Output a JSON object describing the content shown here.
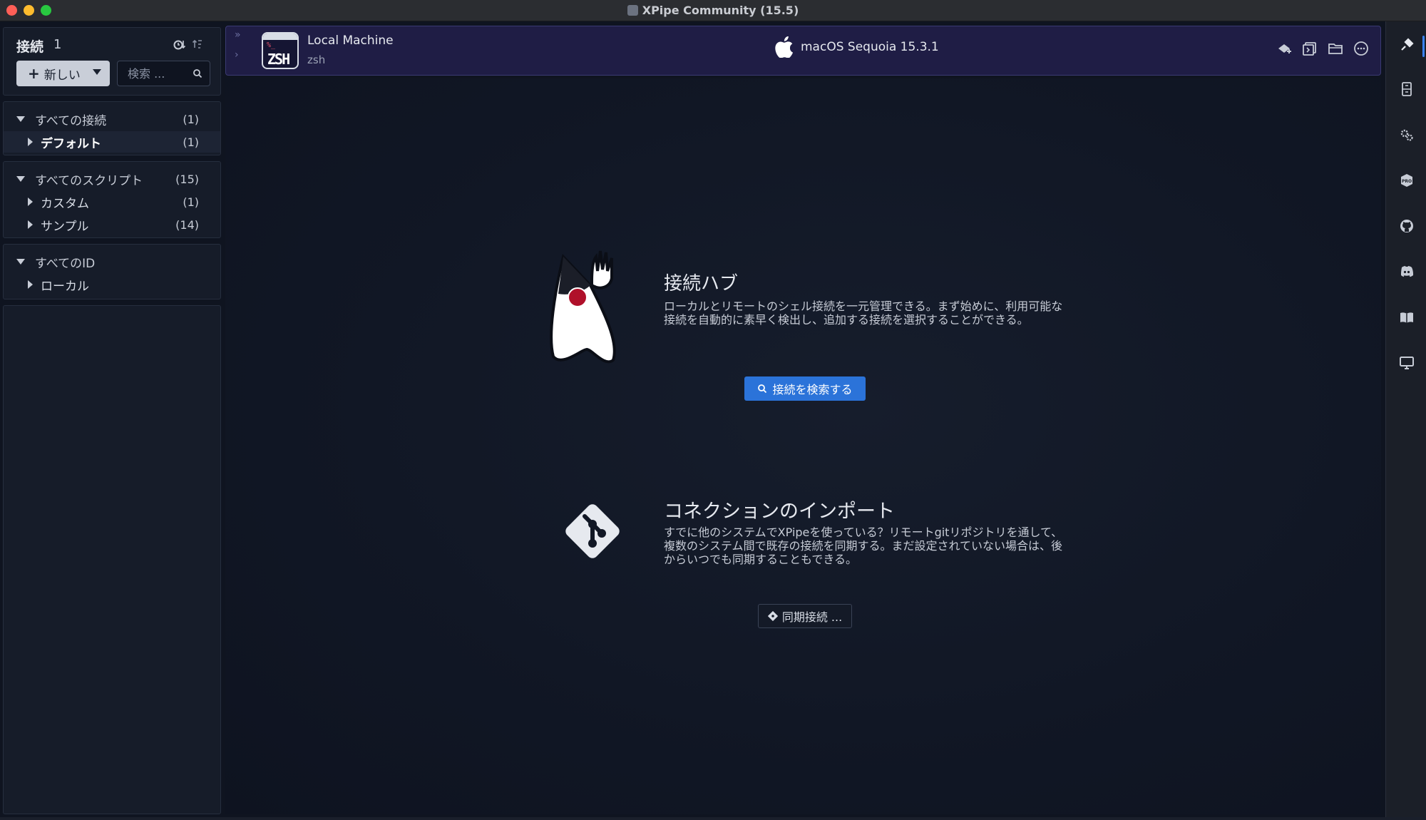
{
  "window": {
    "title": "XPipe Community (15.5)"
  },
  "sidebar": {
    "header": {
      "title": "接続",
      "count": "1"
    },
    "new_button": {
      "label": "新しい"
    },
    "search": {
      "placeholder": "検索 ..."
    },
    "connections": {
      "root": {
        "label": "すべての接続",
        "count": "(1)"
      },
      "children": [
        {
          "label": "デフォルト",
          "count": "(1)"
        }
      ]
    },
    "scripts": {
      "root": {
        "label": "すべてのスクリプト",
        "count": "(15)"
      },
      "children": [
        {
          "label": "カスタム",
          "count": "(1)"
        },
        {
          "label": "サンプル",
          "count": "(14)"
        }
      ]
    },
    "identities": {
      "root": {
        "label": "すべてのID"
      },
      "children": [
        {
          "label": "ローカル"
        }
      ]
    }
  },
  "conn_bar": {
    "machine_name": "Local Machine",
    "shell": "zsh",
    "icon_text": "ZSH",
    "os": "macOS Sequoia 15.3.1"
  },
  "hub": {
    "title": "接続ハブ",
    "description": "ローカルとリモートのシェル接続を一元管理できる。まず始めに、利用可能な接続を自動的に素早く検出し、追加する接続を選択することができる。",
    "button": "接続を検索する"
  },
  "import": {
    "title": "コネクションのインポート",
    "description": "すでに他のシステムでXPipeを使っている？リモートgitリポジトリを通して、複数のシステム間で既存の接続を同期する。まだ設定されていない場合は、後からいつでも同期することもできる。",
    "button": "同期接続 ..."
  },
  "colors": {
    "accent": "#2b73d9",
    "conn_bar": "#1f1d45",
    "background": "#0f1420"
  },
  "rail_icons": [
    "connections-icon",
    "browser-icon",
    "settings-icon",
    "pro-icon",
    "github-icon",
    "discord-icon",
    "docs-icon",
    "desktop-icon"
  ]
}
